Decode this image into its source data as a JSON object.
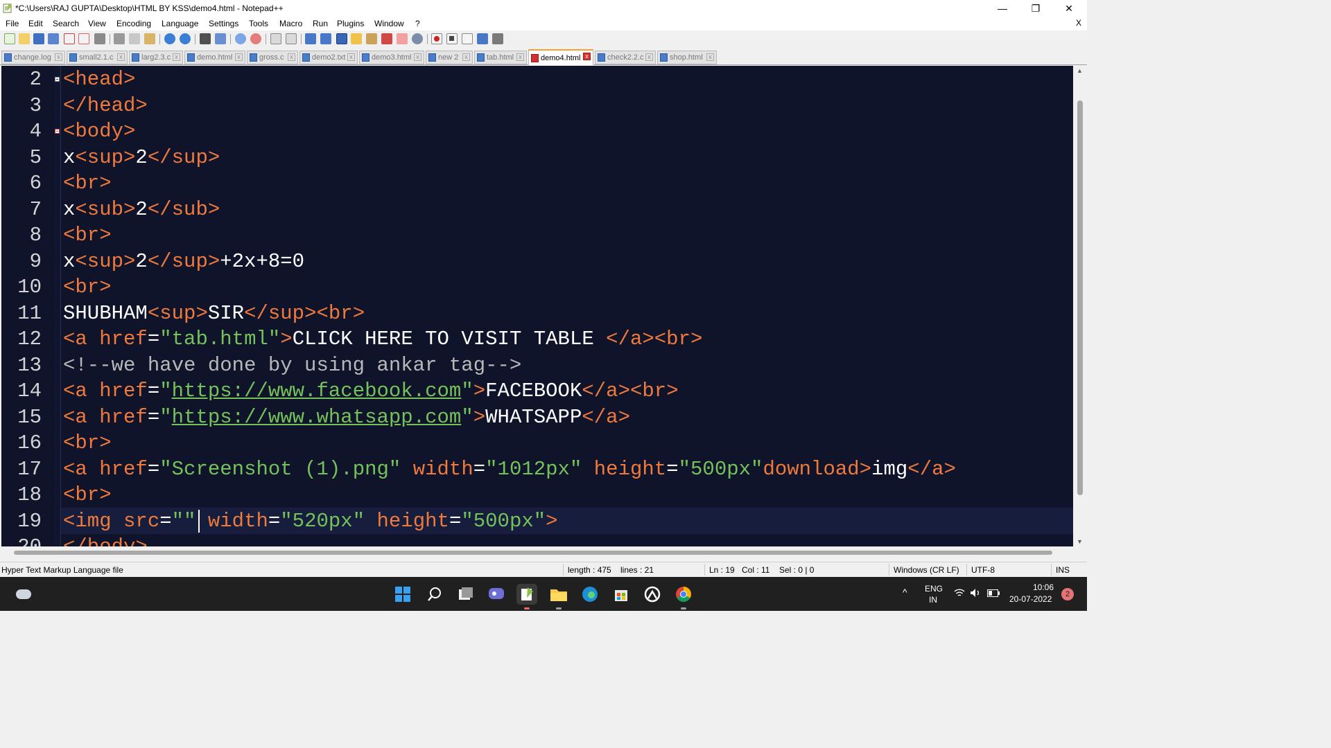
{
  "window": {
    "title": "*C:\\Users\\RAJ GUPTA\\Desktop\\HTML BY KSS\\demo4.html - Notepad++",
    "minimize_glyph": "—",
    "maximize_glyph": "❐",
    "close_glyph": "✕"
  },
  "menu": {
    "items": [
      "File",
      "Edit",
      "Search",
      "View",
      "Encoding",
      "Language",
      "Settings",
      "Tools",
      "Macro",
      "Run",
      "Plugins",
      "Window",
      "?"
    ],
    "close_doc": "X"
  },
  "toolbar": {
    "icons": [
      "new-file",
      "open-file",
      "save",
      "save-all",
      "close",
      "close-all",
      "print",
      "cut",
      "copy",
      "paste",
      "undo",
      "redo",
      "find",
      "replace",
      "zoom-in",
      "zoom-out",
      "sync-vertical",
      "sync-horizontal",
      "word-wrap",
      "show-all-chars",
      "indent-guide",
      "folder-as-workspace",
      "function-list",
      "document-map",
      "monitoring",
      "record-macro",
      "stop-macro",
      "play-macro",
      "run-macro-multiple",
      "save-macro"
    ]
  },
  "tabs": [
    {
      "label": "change.log",
      "active": false
    },
    {
      "label": "small2.1.c",
      "active": false
    },
    {
      "label": "larg2.3.c",
      "active": false
    },
    {
      "label": "demo.html",
      "active": false
    },
    {
      "label": "gross.c",
      "active": false
    },
    {
      "label": "demo2.txt",
      "active": false
    },
    {
      "label": "demo3.html",
      "active": false
    },
    {
      "label": "new 2",
      "active": false
    },
    {
      "label": "tab.html",
      "active": false
    },
    {
      "label": "demo4.html",
      "active": true
    },
    {
      "label": "check2.2.c",
      "active": false
    },
    {
      "label": "shop.html",
      "active": false
    }
  ],
  "editor": {
    "lines": [
      {
        "n": "2",
        "fold": "minus",
        "tokens": [
          [
            "tag",
            "<head>"
          ]
        ]
      },
      {
        "n": "3",
        "fold": "",
        "tokens": [
          [
            "tag",
            "</head>"
          ]
        ]
      },
      {
        "n": "4",
        "fold": "minus-red",
        "tokens": [
          [
            "tag",
            "<body>"
          ]
        ]
      },
      {
        "n": "5",
        "fold": "",
        "tokens": [
          [
            "txt",
            "x"
          ],
          [
            "tag",
            "<sup>"
          ],
          [
            "txt",
            "2"
          ],
          [
            "tag",
            "</sup>"
          ]
        ]
      },
      {
        "n": "6",
        "fold": "",
        "tokens": [
          [
            "tag",
            "<br>"
          ]
        ]
      },
      {
        "n": "7",
        "fold": "",
        "tokens": [
          [
            "txt",
            "x"
          ],
          [
            "tag",
            "<sub>"
          ],
          [
            "txt",
            "2"
          ],
          [
            "tag",
            "</sub>"
          ]
        ]
      },
      {
        "n": "8",
        "fold": "",
        "tokens": [
          [
            "tag",
            "<br>"
          ]
        ]
      },
      {
        "n": "9",
        "fold": "",
        "tokens": [
          [
            "txt",
            "x"
          ],
          [
            "tag",
            "<sup>"
          ],
          [
            "txt",
            "2"
          ],
          [
            "tag",
            "</sup>"
          ],
          [
            "txt",
            "+2x+8=0"
          ]
        ]
      },
      {
        "n": "10",
        "fold": "",
        "tokens": [
          [
            "tag",
            "<br>"
          ]
        ]
      },
      {
        "n": "11",
        "fold": "",
        "tokens": [
          [
            "txt",
            "SHUBHAM"
          ],
          [
            "tag",
            "<sup>"
          ],
          [
            "txt",
            "SIR"
          ],
          [
            "tag",
            "</sup><br>"
          ]
        ]
      },
      {
        "n": "12",
        "fold": "",
        "tokens": [
          [
            "tag",
            "<a "
          ],
          [
            "attr",
            "href"
          ],
          [
            "txt",
            "="
          ],
          [
            "str",
            "\"tab.html\""
          ],
          [
            "tag",
            ">"
          ],
          [
            "txt",
            "CLICK HERE TO VISIT TABLE "
          ],
          [
            "tag",
            "</a><br>"
          ]
        ]
      },
      {
        "n": "13",
        "fold": "",
        "tokens": [
          [
            "cmt",
            "<!--we have done by using ankar tag-->"
          ]
        ]
      },
      {
        "n": "14",
        "fold": "",
        "tokens": [
          [
            "tag",
            "<a "
          ],
          [
            "attr",
            "href"
          ],
          [
            "txt",
            "="
          ],
          [
            "str",
            "\""
          ],
          [
            "url",
            "https://www.facebook.com"
          ],
          [
            "str",
            "\""
          ],
          [
            "tag",
            ">"
          ],
          [
            "txt",
            "FACEBOOK"
          ],
          [
            "tag",
            "</a><br>"
          ]
        ]
      },
      {
        "n": "15",
        "fold": "",
        "tokens": [
          [
            "tag",
            "<a "
          ],
          [
            "attr",
            "href"
          ],
          [
            "txt",
            "="
          ],
          [
            "str",
            "\""
          ],
          [
            "url",
            "https://www.whatsapp.com"
          ],
          [
            "str",
            "\""
          ],
          [
            "tag",
            ">"
          ],
          [
            "txt",
            "WHATSAPP"
          ],
          [
            "tag",
            "</a>"
          ]
        ]
      },
      {
        "n": "16",
        "fold": "",
        "tokens": [
          [
            "tag",
            "<br>"
          ]
        ]
      },
      {
        "n": "17",
        "fold": "",
        "tokens": [
          [
            "tag",
            "<a "
          ],
          [
            "attr",
            "href"
          ],
          [
            "txt",
            "="
          ],
          [
            "str",
            "\"Screenshot (1).png\" "
          ],
          [
            "attr",
            "width"
          ],
          [
            "txt",
            "="
          ],
          [
            "str",
            "\"1012px\" "
          ],
          [
            "attr",
            "height"
          ],
          [
            "txt",
            "="
          ],
          [
            "str",
            "\"500px\""
          ],
          [
            "attr",
            "download"
          ],
          [
            "tag",
            ">"
          ],
          [
            "txt",
            "img"
          ],
          [
            "tag",
            "</a>"
          ]
        ]
      },
      {
        "n": "18",
        "fold": "",
        "tokens": [
          [
            "tag",
            "<br>"
          ]
        ]
      },
      {
        "n": "19",
        "fold": "",
        "current": true,
        "tokens": [
          [
            "tag",
            "<img "
          ],
          [
            "attr",
            "src"
          ],
          [
            "txt",
            "="
          ],
          [
            "str",
            "\"\" "
          ],
          [
            "attr",
            "width"
          ],
          [
            "txt",
            "="
          ],
          [
            "str",
            "\"520px\" "
          ],
          [
            "attr",
            "height"
          ],
          [
            "txt",
            "="
          ],
          [
            "str",
            "\"500px\""
          ],
          [
            "tag",
            ">"
          ]
        ]
      },
      {
        "n": "20",
        "fold": "",
        "tokens": [
          [
            "tag",
            "</body>"
          ]
        ]
      }
    ]
  },
  "status": {
    "filetype": "Hyper Text Markup Language file",
    "length": "length : 475",
    "lines": "lines : 21",
    "ln": "Ln : 19",
    "col": "Col : 11",
    "sel": "Sel : 0 | 0",
    "eol": "Windows (CR LF)",
    "encoding": "UTF-8",
    "mode": "INS"
  },
  "taskbar": {
    "apps": [
      "start",
      "search",
      "task-view",
      "chat",
      "notepadpp",
      "file-explorer",
      "edge",
      "microsoft-store",
      "unknown-app",
      "chrome"
    ],
    "lang_line1": "ENG",
    "lang_line2": "IN",
    "time": "10:06",
    "date": "20-07-2022",
    "notification_count": "2",
    "chevron": "^"
  }
}
